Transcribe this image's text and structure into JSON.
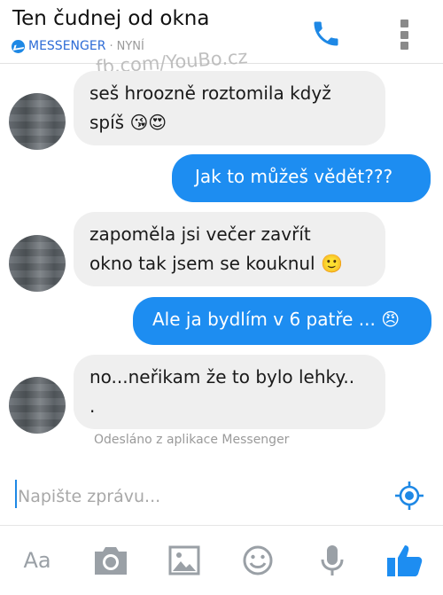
{
  "header": {
    "contact_name": "Ten čudnej od okna",
    "app_label": "MESSENGER",
    "separator": "·",
    "status_time": "NYNÍ",
    "watermark": "fb.com/YouBo.cz"
  },
  "messages": [
    {
      "direction": "incoming",
      "lines": [
        "seš hroozně roztomila když",
        "spíš 😘😍"
      ]
    },
    {
      "direction": "outgoing",
      "lines": [
        "Jak to můžeš vědět???"
      ]
    },
    {
      "direction": "incoming",
      "lines": [
        "zapoměla jsi večer zavřít",
        "okno tak jsem se kouknul 🙂"
      ]
    },
    {
      "direction": "outgoing",
      "lines": [
        "Ale ja bydlím v 6 patře ... 😠"
      ]
    },
    {
      "direction": "incoming",
      "lines": [
        "no...neřikam že to bylo lehky..",
        "."
      ]
    }
  ],
  "sent_note": "Odesláno z aplikace Messenger",
  "composer": {
    "placeholder": "Napište zprávu..."
  },
  "toolbar": {
    "text_format_label": "Aa"
  },
  "colors": {
    "accent": "#1d8df1",
    "incoming_bubble": "#efefef",
    "icon_gray": "#9aa0a6"
  }
}
